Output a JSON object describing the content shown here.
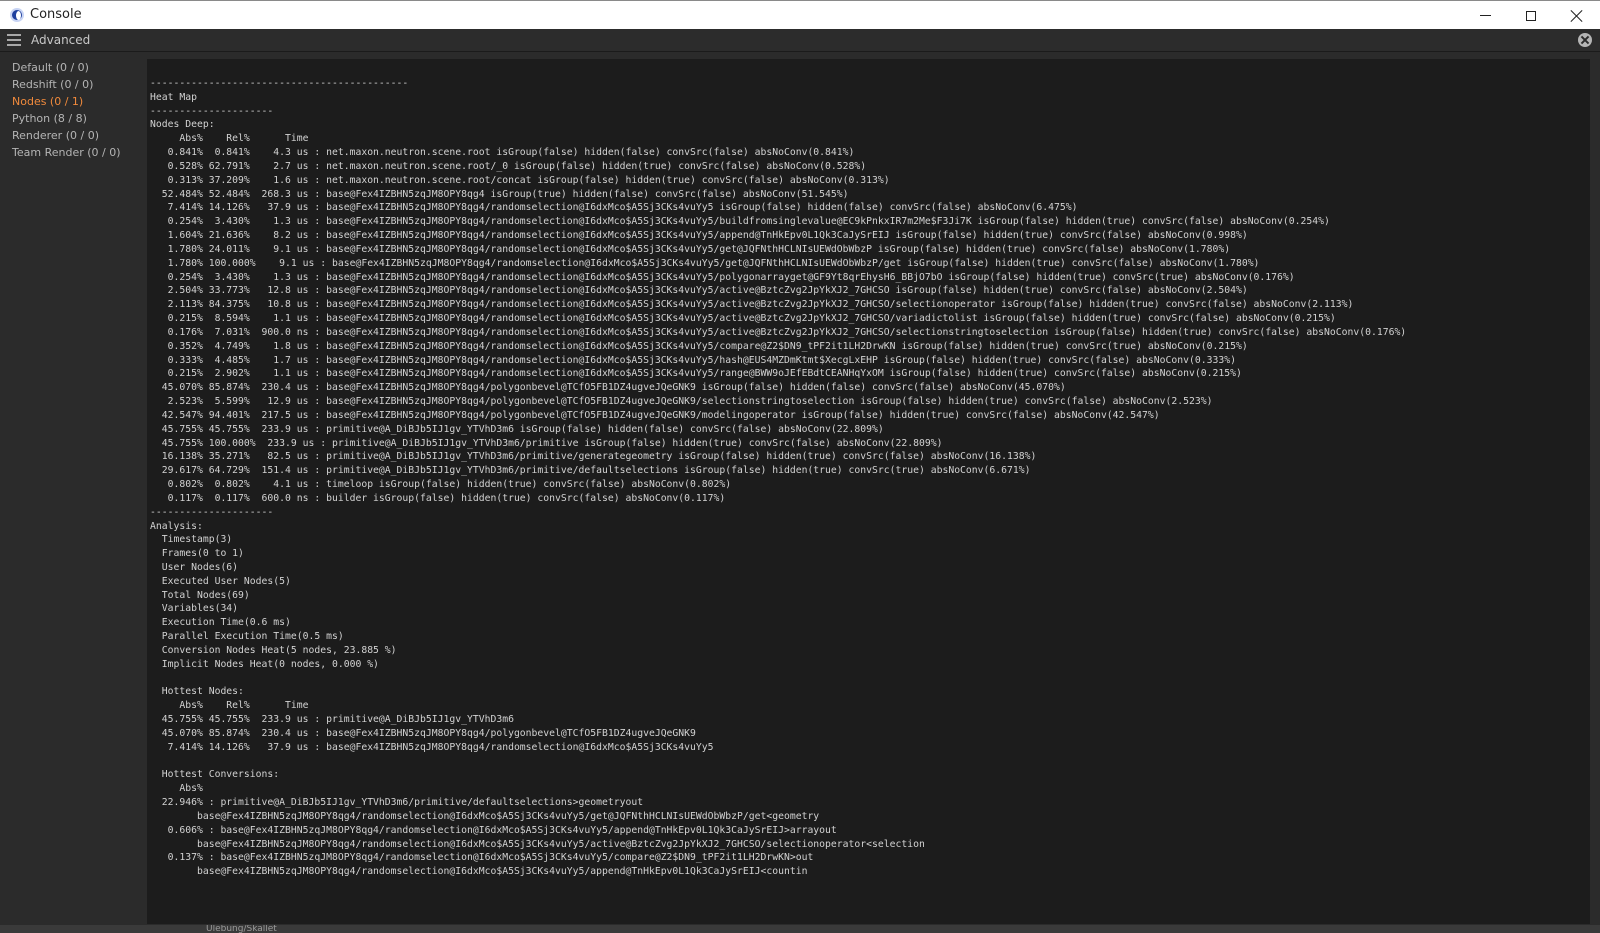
{
  "window": {
    "title": "Console",
    "icon": "cinema4d-logo-icon"
  },
  "menubar": {
    "menu_label": "Advanced"
  },
  "sidebar": {
    "items": [
      {
        "label": "Default (0 / 0)",
        "active": false
      },
      {
        "label": "Redshift (0 / 0)",
        "active": false
      },
      {
        "label": "Nodes (0 / 1)",
        "active": true
      },
      {
        "label": "Python (8 / 8)",
        "active": false
      },
      {
        "label": "Renderer (0 / 0)",
        "active": false
      },
      {
        "label": "Team Render  (0 / 0)",
        "active": false
      }
    ]
  },
  "colors": {
    "active_item": "#f08a3c",
    "console_bg": "#1c1c1c",
    "panel_bg": "#2b2b2b",
    "text": "#d2d2d2"
  },
  "console": {
    "lines": [
      "--------------------------------------------",
      "Heat Map",
      "---------------------",
      "Nodes Deep:",
      "     Abs%    Rel%      Time",
      "   0.841%  0.841%    4.3 us : net.maxon.neutron.scene.root isGroup(false) hidden(false) convSrc(false) absNoConv(0.841%)",
      "   0.528% 62.791%    2.7 us : net.maxon.neutron.scene.root/_0 isGroup(false) hidden(true) convSrc(false) absNoConv(0.528%)",
      "   0.313% 37.209%    1.6 us : net.maxon.neutron.scene.root/concat isGroup(false) hidden(true) convSrc(false) absNoConv(0.313%)",
      "  52.484% 52.484%  268.3 us : base@Fex4IZBHN5zqJM8OPY8qg4 isGroup(true) hidden(false) convSrc(false) absNoConv(51.545%)",
      "   7.414% 14.126%   37.9 us : base@Fex4IZBHN5zqJM8OPY8qg4/randomselection@I6dxMco$A5Sj3CKs4vuYy5 isGroup(false) hidden(false) convSrc(false) absNoConv(6.475%)",
      "   0.254%  3.430%    1.3 us : base@Fex4IZBHN5zqJM8OPY8qg4/randomselection@I6dxMco$A5Sj3CKs4vuYy5/buildfromsinglevalue@EC9kPnkxIR7m2Me$F3Ji7K isGroup(false) hidden(true) convSrc(false) absNoConv(0.254%)",
      "   1.604% 21.636%    8.2 us : base@Fex4IZBHN5zqJM8OPY8qg4/randomselection@I6dxMco$A5Sj3CKs4vuYy5/append@TnHkEpv0L1Qk3CaJySrEIJ isGroup(false) hidden(true) convSrc(false) absNoConv(0.998%)",
      "   1.780% 24.011%    9.1 us : base@Fex4IZBHN5zqJM8OPY8qg4/randomselection@I6dxMco$A5Sj3CKs4vuYy5/get@JQFNthHCLNIsUEWdObWbzP isGroup(false) hidden(true) convSrc(false) absNoConv(1.780%)",
      "   1.780% 100.000%    9.1 us : base@Fex4IZBHN5zqJM8OPY8qg4/randomselection@I6dxMco$A5Sj3CKs4vuYy5/get@JQFNthHCLNIsUEWdObWbzP/get isGroup(false) hidden(true) convSrc(false) absNoConv(1.780%)",
      "   0.254%  3.430%    1.3 us : base@Fex4IZBHN5zqJM8OPY8qg4/randomselection@I6dxMco$A5Sj3CKs4vuYy5/polygonarrayget@GF9Yt8qrEhysH6_BBjO7bO isGroup(false) hidden(true) convSrc(true) absNoConv(0.176%)",
      "   2.504% 33.773%   12.8 us : base@Fex4IZBHN5zqJM8OPY8qg4/randomselection@I6dxMco$A5Sj3CKs4vuYy5/active@BztcZvg2JpYkXJ2_7GHCSO isGroup(false) hidden(true) convSrc(false) absNoConv(2.504%)",
      "   2.113% 84.375%   10.8 us : base@Fex4IZBHN5zqJM8OPY8qg4/randomselection@I6dxMco$A5Sj3CKs4vuYy5/active@BztcZvg2JpYkXJ2_7GHCSO/selectionoperator isGroup(false) hidden(true) convSrc(false) absNoConv(2.113%)",
      "   0.215%  8.594%    1.1 us : base@Fex4IZBHN5zqJM8OPY8qg4/randomselection@I6dxMco$A5Sj3CKs4vuYy5/active@BztcZvg2JpYkXJ2_7GHCSO/variadictolist isGroup(false) hidden(true) convSrc(false) absNoConv(0.215%)",
      "   0.176%  7.031%  900.0 ns : base@Fex4IZBHN5zqJM8OPY8qg4/randomselection@I6dxMco$A5Sj3CKs4vuYy5/active@BztcZvg2JpYkXJ2_7GHCSO/selectionstringtoselection isGroup(false) hidden(true) convSrc(false) absNoConv(0.176%)",
      "   0.352%  4.749%    1.8 us : base@Fex4IZBHN5zqJM8OPY8qg4/randomselection@I6dxMco$A5Sj3CKs4vuYy5/compare@Z2$DN9_tPF2it1LH2DrwKN isGroup(false) hidden(true) convSrc(true) absNoConv(0.215%)",
      "   0.333%  4.485%    1.7 us : base@Fex4IZBHN5zqJM8OPY8qg4/randomselection@I6dxMco$A5Sj3CKs4vuYy5/hash@EUS4MZDmKtmt$XecgLxEHP isGroup(false) hidden(true) convSrc(false) absNoConv(0.333%)",
      "   0.215%  2.902%    1.1 us : base@Fex4IZBHN5zqJM8OPY8qg4/randomselection@I6dxMco$A5Sj3CKs4vuYy5/range@BWW9oJEfEBdtCEANHqYxOM isGroup(false) hidden(true) convSrc(false) absNoConv(0.215%)",
      "  45.070% 85.874%  230.4 us : base@Fex4IZBHN5zqJM8OPY8qg4/polygonbevel@TCfO5FB1DZ4ugveJQeGNK9 isGroup(false) hidden(false) convSrc(false) absNoConv(45.070%)",
      "   2.523%  5.599%   12.9 us : base@Fex4IZBHN5zqJM8OPY8qg4/polygonbevel@TCfO5FB1DZ4ugveJQeGNK9/selectionstringtoselection isGroup(false) hidden(true) convSrc(false) absNoConv(2.523%)",
      "  42.547% 94.401%  217.5 us : base@Fex4IZBHN5zqJM8OPY8qg4/polygonbevel@TCfO5FB1DZ4ugveJQeGNK9/modelingoperator isGroup(false) hidden(true) convSrc(false) absNoConv(42.547%)",
      "  45.755% 45.755%  233.9 us : primitive@A_DiBJb5IJ1gv_YTVhD3m6 isGroup(false) hidden(false) convSrc(false) absNoConv(22.809%)",
      "  45.755% 100.000%  233.9 us : primitive@A_DiBJb5IJ1gv_YTVhD3m6/primitive isGroup(false) hidden(true) convSrc(false) absNoConv(22.809%)",
      "  16.138% 35.271%   82.5 us : primitive@A_DiBJb5IJ1gv_YTVhD3m6/primitive/generategeometry isGroup(false) hidden(true) convSrc(false) absNoConv(16.138%)",
      "  29.617% 64.729%  151.4 us : primitive@A_DiBJb5IJ1gv_YTVhD3m6/primitive/defaultselections isGroup(false) hidden(true) convSrc(true) absNoConv(6.671%)",
      "   0.802%  0.802%    4.1 us : timeloop isGroup(false) hidden(true) convSrc(false) absNoConv(0.802%)",
      "   0.117%  0.117%  600.0 ns : builder isGroup(false) hidden(true) convSrc(false) absNoConv(0.117%)",
      "---------------------",
      "Analysis:",
      "  Timestamp(3)",
      "  Frames(0 to 1)",
      "  User Nodes(6)",
      "  Executed User Nodes(5)",
      "  Total Nodes(69)",
      "  Variables(34)",
      "  Execution Time(0.6 ms)",
      "  Parallel Execution Time(0.5 ms)",
      "  Conversion Nodes Heat(5 nodes, 23.885 %)",
      "  Implicit Nodes Heat(0 nodes, 0.000 %)",
      "",
      "  Hottest Nodes:",
      "     Abs%    Rel%      Time",
      "  45.755% 45.755%  233.9 us : primitive@A_DiBJb5IJ1gv_YTVhD3m6",
      "  45.070% 85.874%  230.4 us : base@Fex4IZBHN5zqJM8OPY8qg4/polygonbevel@TCfO5FB1DZ4ugveJQeGNK9",
      "   7.414% 14.126%   37.9 us : base@Fex4IZBHN5zqJM8OPY8qg4/randomselection@I6dxMco$A5Sj3CKs4vuYy5",
      "",
      "  Hottest Conversions:",
      "     Abs%",
      "  22.946% : primitive@A_DiBJb5IJ1gv_YTVhD3m6/primitive/defaultselections>geometryout",
      "        base@Fex4IZBHN5zqJM8OPY8qg4/randomselection@I6dxMco$A5Sj3CKs4vuYy5/get@JQFNthHCLNIsUEWdObWbzP/get<geometry",
      "   0.606% : base@Fex4IZBHN5zqJM8OPY8qg4/randomselection@I6dxMco$A5Sj3CKs4vuYy5/append@TnHkEpv0L1Qk3CaJySrEIJ>arrayout",
      "        base@Fex4IZBHN5zqJM8OPY8qg4/randomselection@I6dxMco$A5Sj3CKs4vuYy5/active@BztcZvg2JpYkXJ2_7GHCSO/selectionoperator<selection",
      "   0.137% : base@Fex4IZBHN5zqJM8OPY8qg4/randomselection@I6dxMco$A5Sj3CKs4vuYy5/compare@Z2$DN9_tPF2it1LH2DrwKN>out",
      "        base@Fex4IZBHN5zqJM8OPY8qg4/randomselection@I6dxMco$A5Sj3CKs4vuYy5/append@TnHkEpv0L1Qk3CaJySrEIJ<countin"
    ]
  },
  "bottom_bar": {
    "label": "Ulebung/Skallet"
  }
}
